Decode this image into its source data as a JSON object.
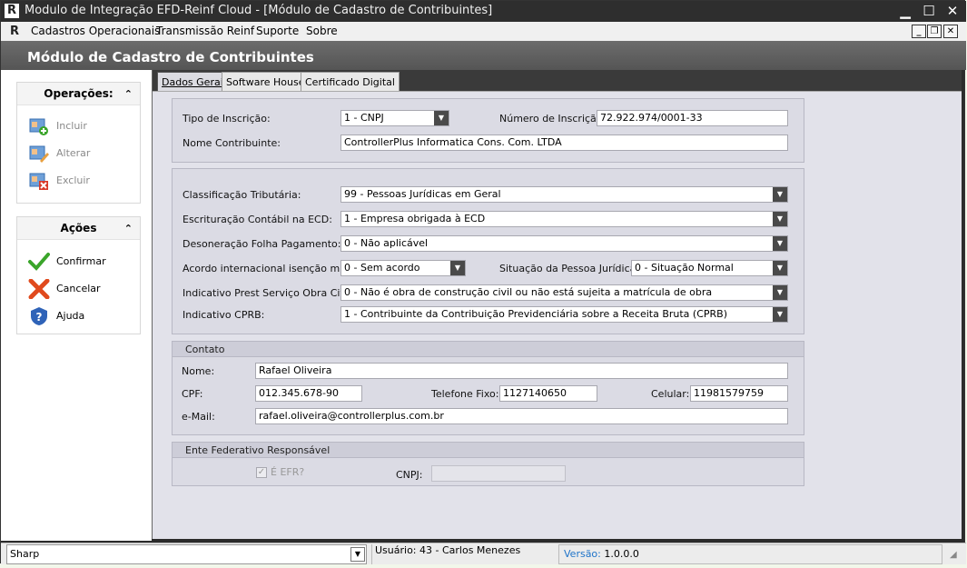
{
  "window": {
    "title": "Modulo de Integração EFD-Reinf Cloud - [Módulo de Cadastro de Contribuintes]",
    "logo_text": "R"
  },
  "menubar": {
    "items": [
      "Cadastros Operacionais",
      "Transmissão Reinf",
      "Suporte",
      "Sobre"
    ]
  },
  "header": {
    "title": "Módulo de Cadastro de Contribuintes"
  },
  "sidebar": {
    "operacoes": {
      "title": "Operações:",
      "items": [
        {
          "label": "Incluir",
          "icon": "add-record-icon"
        },
        {
          "label": "Alterar",
          "icon": "edit-record-icon"
        },
        {
          "label": "Excluir",
          "icon": "delete-record-icon"
        }
      ]
    },
    "acoes": {
      "title": "Ações",
      "items": [
        {
          "label": "Confirmar",
          "icon": "check-icon"
        },
        {
          "label": "Cancelar",
          "icon": "x-icon"
        },
        {
          "label": "Ajuda",
          "icon": "help-shield-icon"
        }
      ]
    }
  },
  "tabs": [
    "Dados Gerais",
    "Software House",
    "Certificado Digital"
  ],
  "identificacao": {
    "tipo_label": "Tipo de Inscrição:",
    "tipo_value": "1 - CNPJ",
    "numero_label": "Número de Inscrição:",
    "numero_value": "72.922.974/0001-33",
    "nome_label": "Nome Contribuinte:",
    "nome_value": "ControllerPlus Informatica Cons. Com. LTDA"
  },
  "classificacao": {
    "class_label": "Classificação Tributária:",
    "class_value": "99 - Pessoas Jurídicas em Geral",
    "ecd_label": "Escrituração Contábil na ECD:",
    "ecd_value": "1 - Empresa obrigada à ECD",
    "deson_label": "Desoneração Folha Pagamento:",
    "deson_value": "0 - Não aplicável",
    "acordo_label": "Acordo internacional isenção multa:",
    "acordo_value": "0 - Sem acordo",
    "situacao_label": "Situação da Pessoa Jurídica:",
    "situacao_value": "0 - Situação Normal",
    "obra_label": "Indicativo Prest Serviço Obra Civil:",
    "obra_value": "0 - Não é obra de construção civil ou não está sujeita a matrícula de obra",
    "cprb_label": "Indicativo CPRB:",
    "cprb_value": "1 - Contribuinte da Contribuição Previdenciária sobre a Receita Bruta (CPRB)"
  },
  "contato": {
    "title": "Contato",
    "nome_label": "Nome:",
    "nome_value": "Rafael Oliveira",
    "cpf_label": "CPF:",
    "cpf_value": "012.345.678-90",
    "tel_label": "Telefone Fixo:",
    "tel_value": "1127140650",
    "cel_label": "Celular:",
    "cel_value": "11981579759",
    "email_label": "e-Mail:",
    "email_value": "rafael.oliveira@controllerplus.com.br"
  },
  "ente": {
    "title": "Ente Federativo Responsável",
    "efr_label": "É EFR?",
    "efr_checked": true,
    "cnpj_label": "CNPJ:",
    "cnpj_value": ""
  },
  "statusbar": {
    "theme_value": "Sharp",
    "user_text": "Usuário: 43 - Carlos Menezes",
    "version_label": "Versão:",
    "version_value": "1.0.0.0"
  },
  "colors": {
    "accent_blue": "#1e73c8",
    "header_bg": "#5e5e5e",
    "check_green": "#3aa52a",
    "cancel_red": "#e04a1e"
  }
}
